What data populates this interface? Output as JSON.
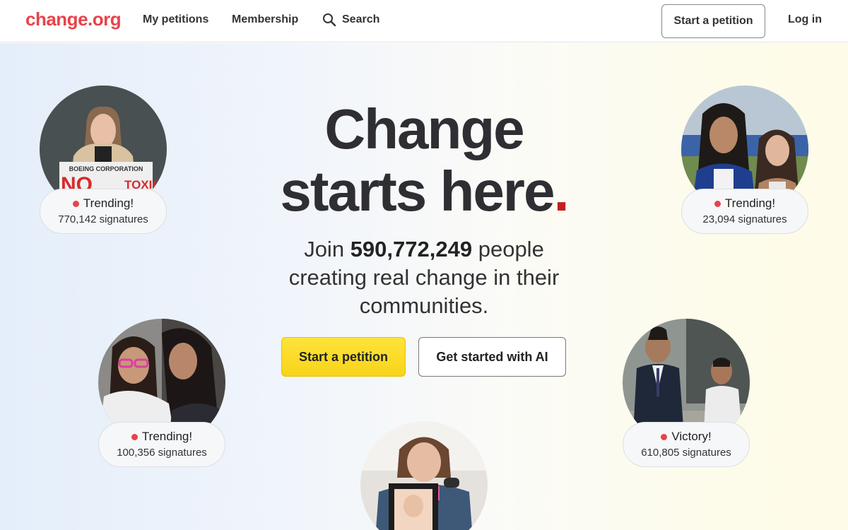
{
  "header": {
    "logo": "change.org",
    "nav": {
      "my_petitions": "My petitions",
      "membership": "Membership",
      "search": "Search"
    },
    "start_petition": "Start a petition",
    "login": "Log in"
  },
  "hero": {
    "headline_line1": "Change",
    "headline_line2": "starts here",
    "headline_dot": ".",
    "sub_join": "Join",
    "sub_count": "590,772,249",
    "sub_rest": "people creating real change in their communities.",
    "primary_button": "Start a petition",
    "secondary_button": "Get started with AI"
  },
  "petitions": [
    {
      "status": "Trending!",
      "signatures": "770,142 signatures",
      "photo_sign_text_1": "BOEING CORPORATION",
      "photo_sign_text_2": "TOXIC"
    },
    {
      "status": "Trending!",
      "signatures": "23,094 signatures"
    },
    {
      "status": "Trending!",
      "signatures": "100,356 signatures"
    },
    {
      "status": "Victory!",
      "signatures": "610,805 signatures"
    }
  ],
  "colors": {
    "brand": "#e8434a",
    "accent_yellow": "#f7d41a",
    "headline_dot": "#c3201d"
  }
}
